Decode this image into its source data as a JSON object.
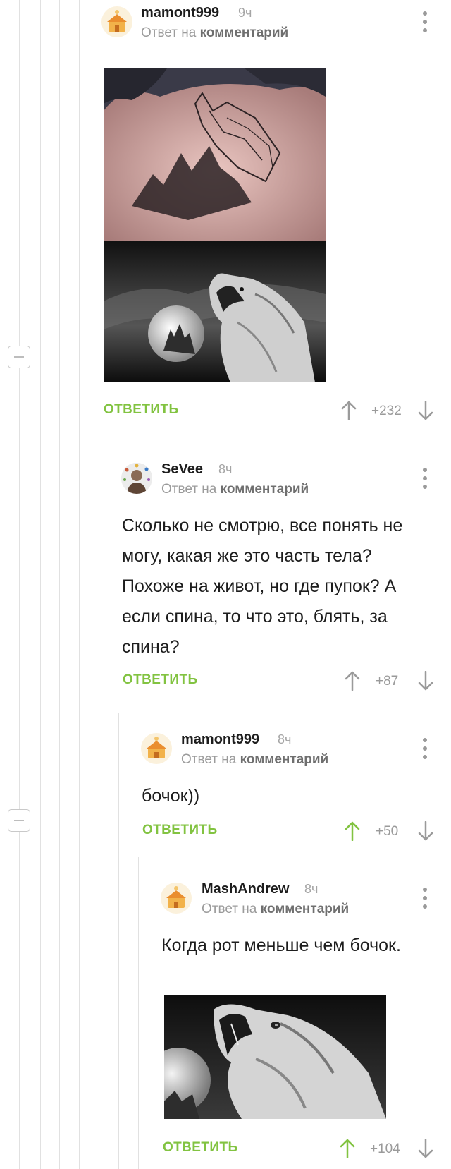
{
  "reply_prefix": "Ответ на",
  "reply_target": "комментарий",
  "reply_label": "ОТВЕТИТЬ",
  "colors": {
    "accent_green": "#82c341",
    "muted": "#9a9a9a",
    "thread_line": "#e1e1e1"
  },
  "comments": [
    {
      "username": "mamont999",
      "time": "9ч",
      "text": "",
      "score": "+232",
      "voted": "none",
      "has_image": true
    },
    {
      "username": "SeVee",
      "time": "8ч",
      "text": "Сколько не смотрю, все понять не могу, какая же это часть тела? Похоже на живот, но где пупок? А если спина, то что это, блять, за спина?",
      "score": "+87",
      "voted": "none",
      "has_image": false
    },
    {
      "username": "mamont999",
      "time": "8ч",
      "text": "бочок))",
      "score": "+50",
      "voted": "up",
      "has_image": false
    },
    {
      "username": "MashAndrew",
      "time": "8ч",
      "text": "Когда рот меньше чем бочок.",
      "score": "+104",
      "voted": "up",
      "has_image": true
    }
  ]
}
